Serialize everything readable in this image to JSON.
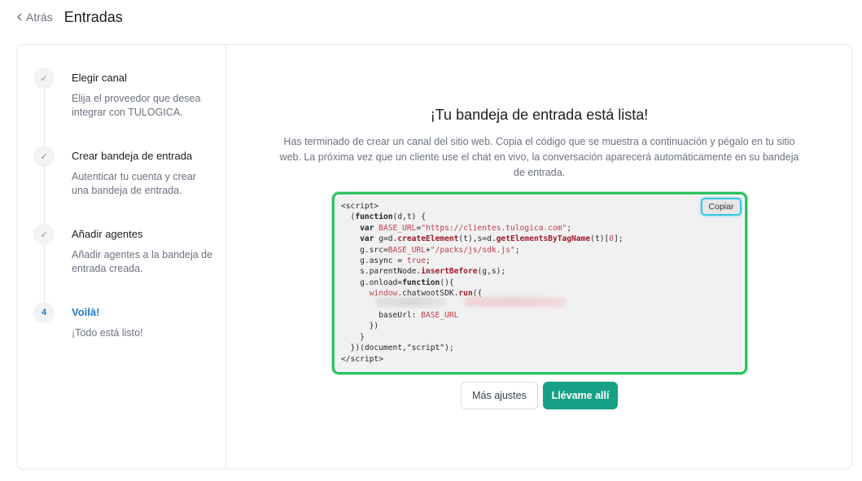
{
  "header": {
    "back_label": "Atrás",
    "title": "Entradas"
  },
  "steps": [
    {
      "marker": "✓",
      "title": "Elegir canal",
      "description": "Elija el proveedor que desea integrar con TULOGICA."
    },
    {
      "marker": "✓",
      "title": "Crear bandeja de entrada",
      "description": "Autenticar tu cuenta y crear una bandeja de entrada."
    },
    {
      "marker": "✓",
      "title": "Añadir agentes",
      "description": "Añadir agentes a la bandeja de entrada creada."
    },
    {
      "marker": "4",
      "title": "Voilà!",
      "description": "¡Todo está listo!"
    }
  ],
  "main": {
    "heading": "¡Tu bandeja de entrada está lista!",
    "lead": "Has terminado de crear un canal del sitio web. Copia el código que se muestra a continuación y pégalo en tu sitio web. La próxima vez que un cliente use el chat en vivo, la conversación aparecerá automáticamente en su bandeja de entrada.",
    "copy_label": "Copiar",
    "code": {
      "base_url": "\"https://clientes.tulogica.com\"",
      "sdk_path": "\"/packs/js/sdk.js\"",
      "doc_args": "(document,\"script\");"
    },
    "more_settings_label": "Más ajustes",
    "take_me_label": "Llévame allí"
  },
  "colors": {
    "accent": "#16a085",
    "active_step": "#1f7ad1",
    "highlight_green": "#2bc45e",
    "highlight_cyan": "#35c7e6"
  },
  "icons": {
    "back": "chevron-left-icon",
    "done": "check-icon"
  }
}
